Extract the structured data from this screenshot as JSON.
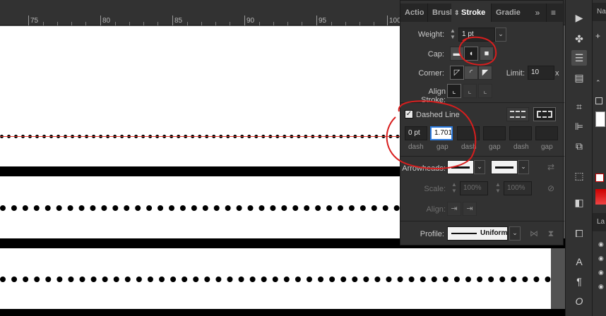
{
  "ruler": {
    "labels": [
      "75",
      "80",
      "85",
      "90",
      "95",
      "100"
    ]
  },
  "stroke_panel": {
    "tabs": [
      {
        "label": "Actio",
        "active": false
      },
      {
        "label": "Brush",
        "active": false
      },
      {
        "label": "Stroke",
        "active": true
      },
      {
        "label": "Gradie",
        "active": false
      }
    ],
    "more_glyph": "»",
    "menu_glyph": "≡",
    "weight_label": "Weight:",
    "weight_value": "1 pt",
    "cap_label": "Cap:",
    "corner_label": "Corner:",
    "limit_label": "Limit:",
    "limit_value": "10",
    "limit_unit": "x",
    "align_stroke_label": "Align Stroke:",
    "dashed_line_label": "Dashed Line",
    "dashed_line_checked": true,
    "dash_fields": [
      {
        "value": "0 pt",
        "label": "dash"
      },
      {
        "value": "1.701",
        "label": "gap"
      },
      {
        "value": "",
        "label": "dash"
      },
      {
        "value": "",
        "label": "gap"
      },
      {
        "value": "",
        "label": "dash"
      },
      {
        "value": "",
        "label": "gap"
      }
    ],
    "arrowheads_label": "Arrowheads:",
    "scale_label": "Scale:",
    "scale_start": "100%",
    "scale_end": "100%",
    "align_label": "Align:",
    "profile_label": "Profile:",
    "profile_value": "Uniform"
  },
  "side_panel": {
    "top_tab": "Na",
    "layers_tab": "La"
  },
  "colors": {
    "annotation_red": "#d81e1e",
    "focus_blue": "#2b7be0",
    "panel_bg": "#323232"
  }
}
